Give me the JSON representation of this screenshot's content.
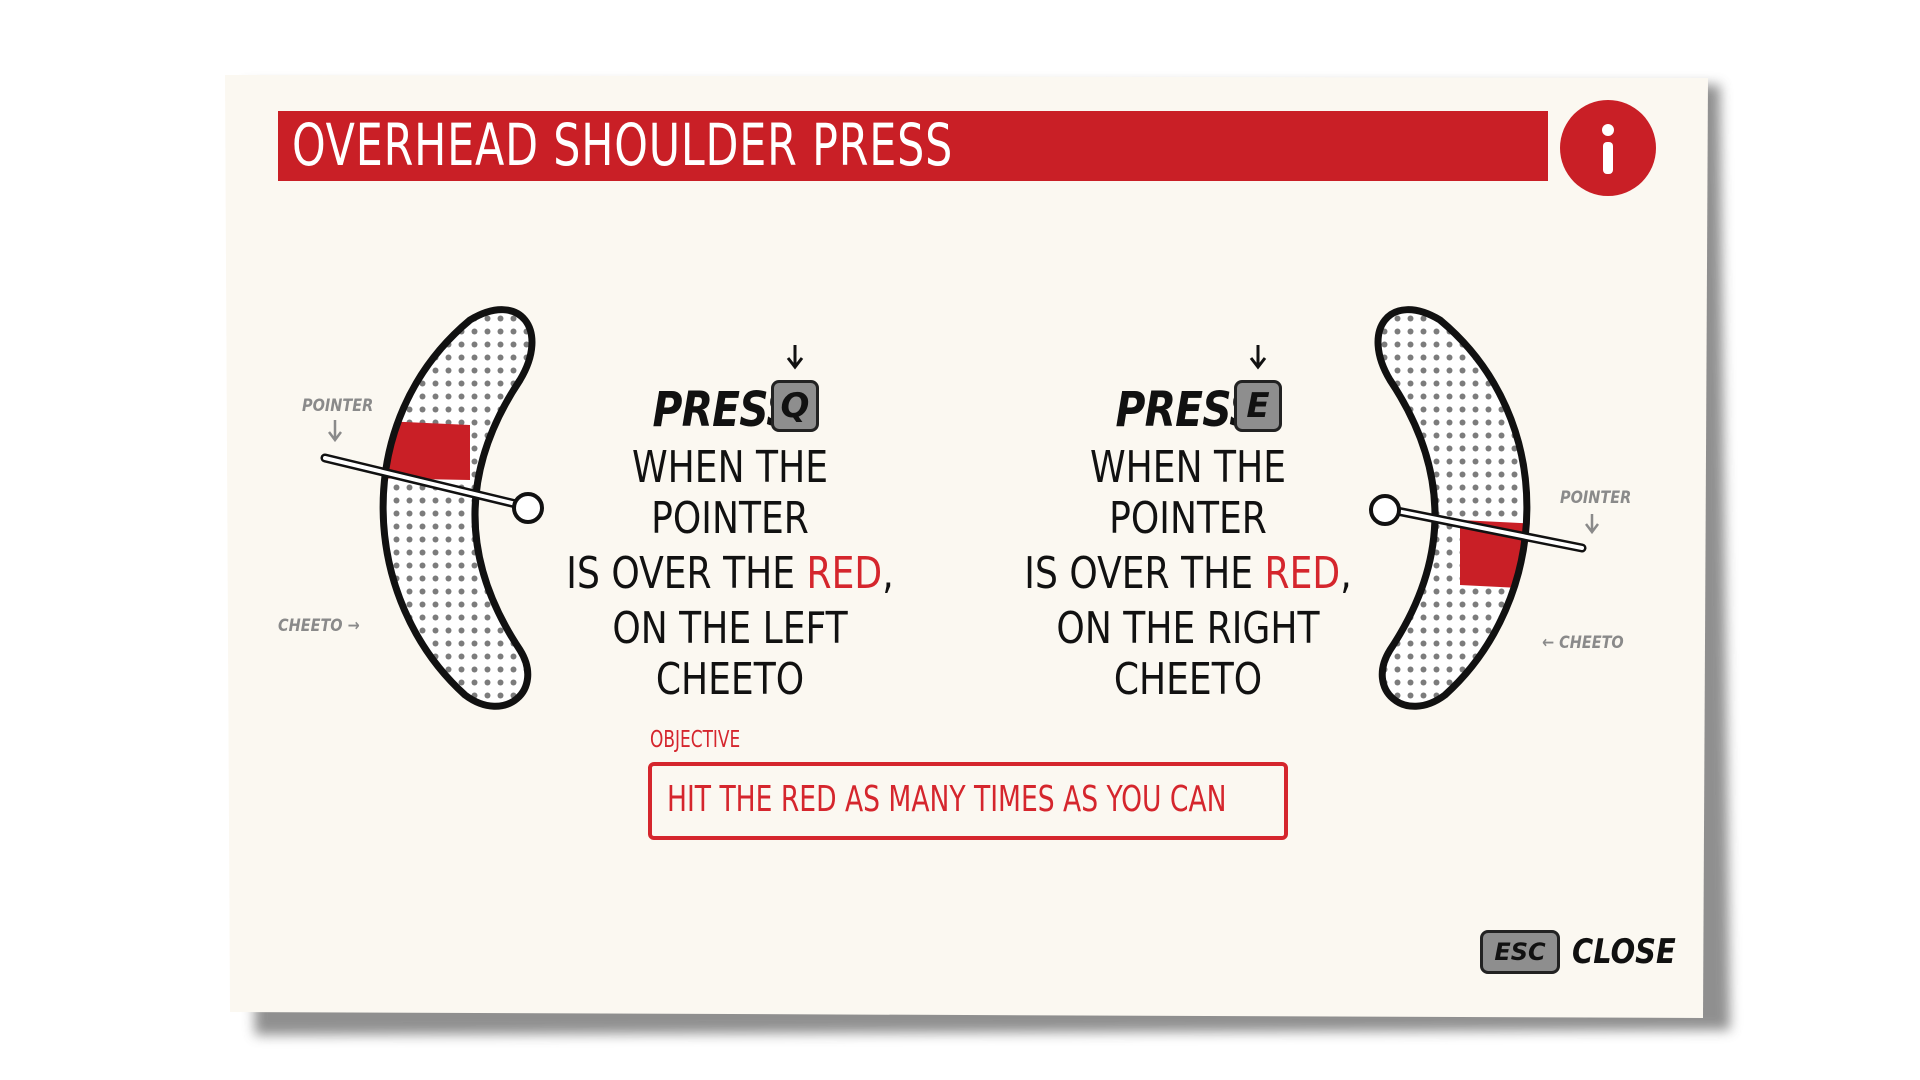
{
  "title": "OVERHEAD SHOULDER PRESS",
  "info_icon": "info-icon",
  "left_instruction": {
    "press_label": "PRESS",
    "key": "Q",
    "line1": "WHEN THE POINTER",
    "line2_prefix": "IS OVER THE ",
    "line2_highlight": "RED",
    "line2_suffix": ",",
    "line3": "ON THE LEFT CHEETO"
  },
  "right_instruction": {
    "press_label": "PRESS",
    "key": "E",
    "line1": "WHEN THE POINTER",
    "line2_prefix": "IS OVER THE ",
    "line2_highlight": "RED",
    "line2_suffix": ",",
    "line3": "ON THE RIGHT CHEETO"
  },
  "left_diagram": {
    "pointer_label": "POINTER",
    "cheeto_label": "CHEETO →"
  },
  "right_diagram": {
    "pointer_label": "POINTER",
    "cheeto_label": "← CHEETO"
  },
  "objective": {
    "label": "OBJECTIVE",
    "text": "HIT THE RED AS MANY TIMES AS YOU CAN"
  },
  "close": {
    "key": "ESC",
    "label": "CLOSE"
  },
  "colors": {
    "accent_red": "#c91f26",
    "paper": "#fbf8f1",
    "ink": "#111111",
    "muted_gray": "#8a8a8a"
  }
}
